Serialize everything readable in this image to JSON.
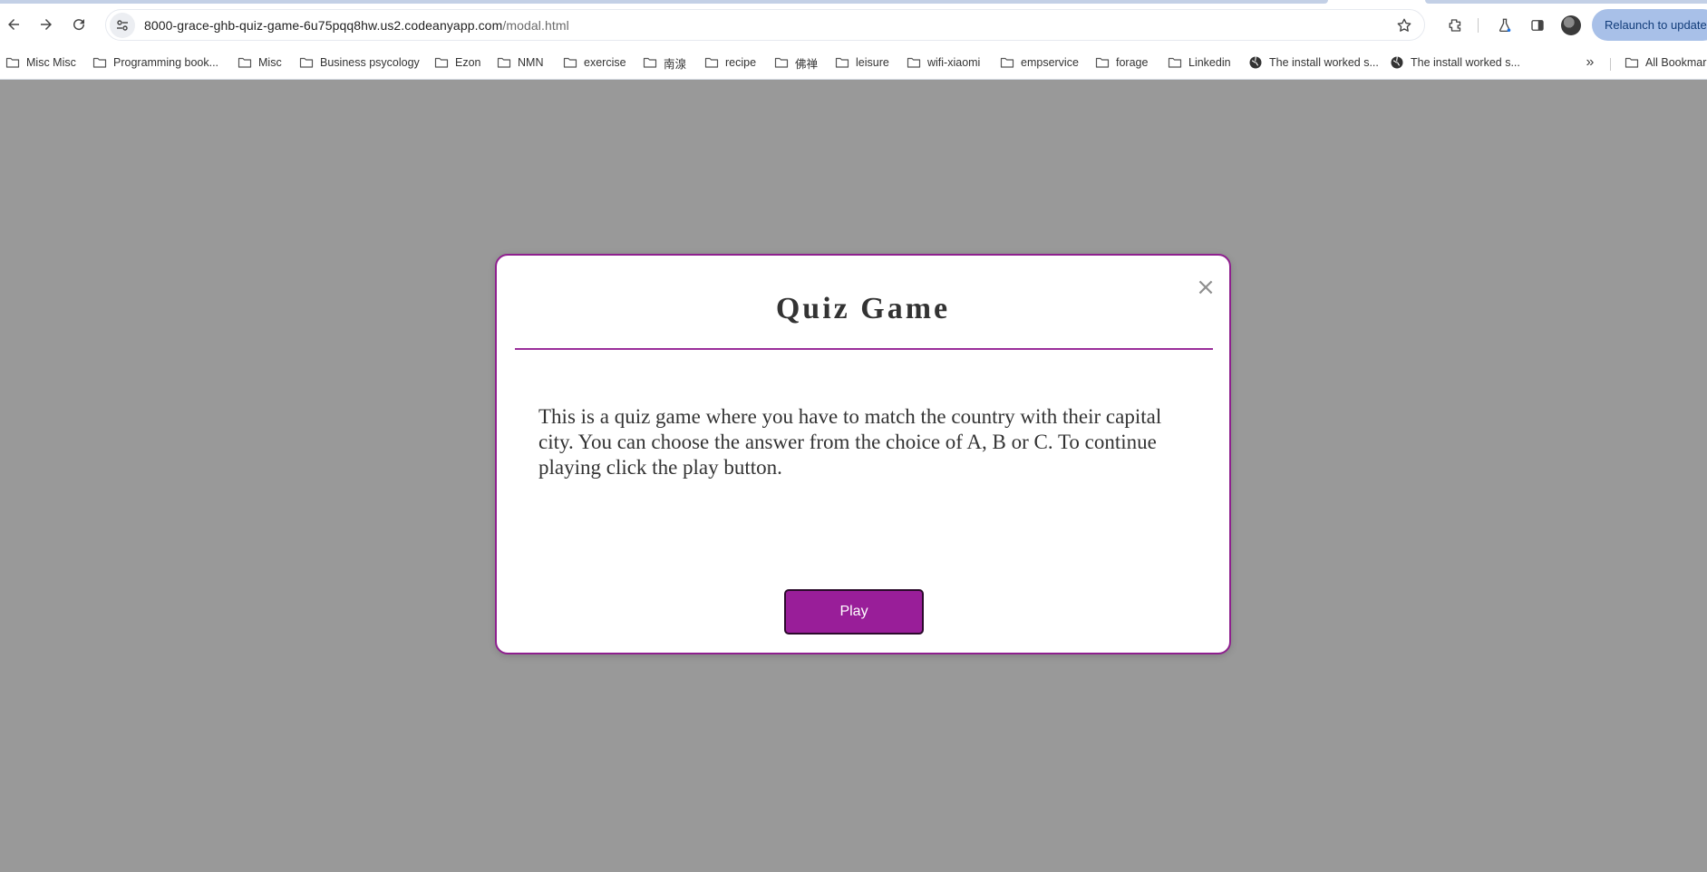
{
  "browser": {
    "url_host": "8000-grace-ghb-quiz-game-6u75pqq8hw.us2.codeanyapp.com",
    "url_path": "/modal.html",
    "relaunch_label": "Relaunch to update",
    "bookmarks": [
      {
        "label": "Misc Misc",
        "icon": "folder-icon"
      },
      {
        "label": "Programming book...",
        "icon": "folder-icon"
      },
      {
        "label": "Misc",
        "icon": "folder-icon"
      },
      {
        "label": "Business psycology",
        "icon": "folder-icon"
      },
      {
        "label": "Ezon",
        "icon": "folder-icon"
      },
      {
        "label": "NMN",
        "icon": "folder-icon"
      },
      {
        "label": "exercise",
        "icon": "folder-icon"
      },
      {
        "label": "南湶",
        "icon": "folder-icon"
      },
      {
        "label": "recipe",
        "icon": "folder-icon"
      },
      {
        "label": "佛禅",
        "icon": "folder-icon"
      },
      {
        "label": "leisure",
        "icon": "folder-icon"
      },
      {
        "label": "wifi-xiaomi",
        "icon": "folder-icon"
      },
      {
        "label": "empservice",
        "icon": "folder-icon"
      },
      {
        "label": "forage",
        "icon": "folder-icon"
      },
      {
        "label": "Linkedin",
        "icon": "folder-icon"
      },
      {
        "label": "The install worked s...",
        "icon": "globe-icon"
      },
      {
        "label": "The install worked s...",
        "icon": "globe-icon"
      }
    ],
    "more_label": "»",
    "all_bookmarks_label": "All Bookmarks"
  },
  "modal": {
    "title": "Quiz Game",
    "close_label": "×",
    "body": "This is a quiz game where you have to match the country with their capital city. You can choose the answer from the choice of A, B or C. To continue playing click the play button.",
    "play_label": "Play"
  },
  "colors": {
    "accent": "#991e99",
    "modal_border": "#8e1f8e",
    "backdrop": "#999999"
  }
}
